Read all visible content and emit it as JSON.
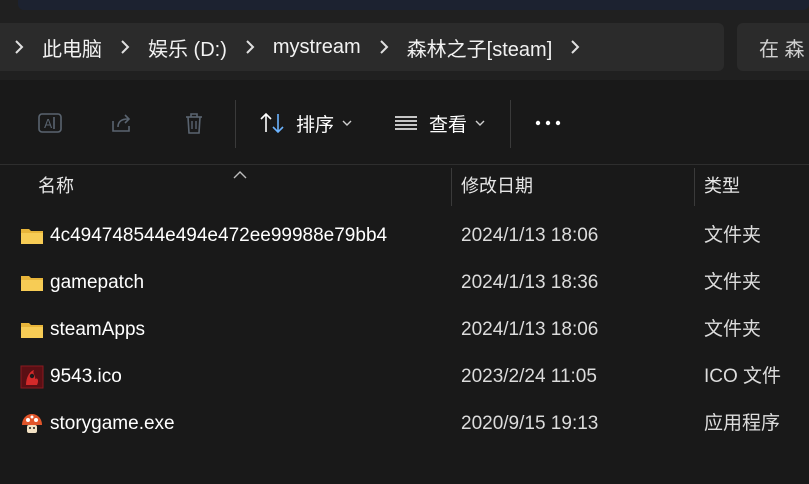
{
  "breadcrumb": {
    "items": [
      "此电脑",
      "娱乐 (D:)",
      "mystream",
      "森林之子[steam]"
    ]
  },
  "search": {
    "placeholder": "在 森"
  },
  "toolbar": {
    "sort_label": "排序",
    "view_label": "查看"
  },
  "columns": {
    "name": "名称",
    "date": "修改日期",
    "type": "类型"
  },
  "files": [
    {
      "name": "4c494748544e494e472ee99988e79bb4",
      "date": "2024/1/13 18:06",
      "type": "文件夹",
      "icon": "folder-icon"
    },
    {
      "name": "gamepatch",
      "date": "2024/1/13 18:36",
      "type": "文件夹",
      "icon": "folder-icon"
    },
    {
      "name": "steamApps",
      "date": "2024/1/13 18:06",
      "type": "文件夹",
      "icon": "folder-icon"
    },
    {
      "name": "9543.ico",
      "date": "2023/2/24 11:05",
      "type": "ICO 文件",
      "icon": "ico-image-icon"
    },
    {
      "name": "storygame.exe",
      "date": "2020/9/15 19:13",
      "type": "应用程序",
      "icon": "exe-app-icon"
    }
  ],
  "colors": {
    "background": "#191919",
    "folder": "#f5c244",
    "text": "#ffffff"
  }
}
